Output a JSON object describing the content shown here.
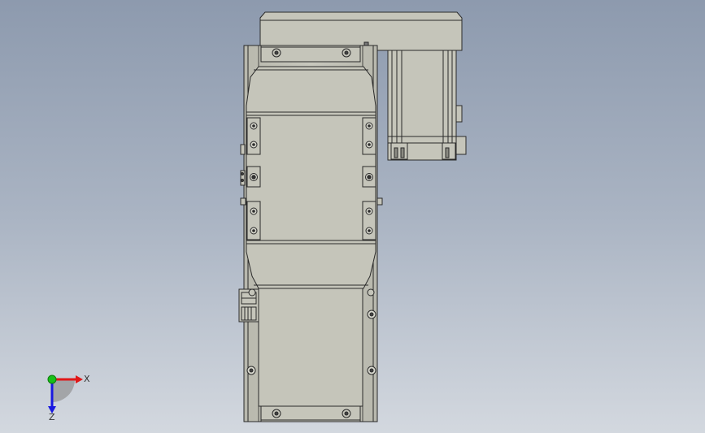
{
  "viewport": {
    "background_top": "#8d9aae",
    "background_bottom": "#d3d8df",
    "part_fill": "#c5c5ba",
    "part_stroke": "#2a2a2a"
  },
  "triad": {
    "x_label": "X",
    "z_label": "Z",
    "x_color": "#e01818",
    "y_color": "#18c018",
    "z_color": "#1818e0"
  }
}
